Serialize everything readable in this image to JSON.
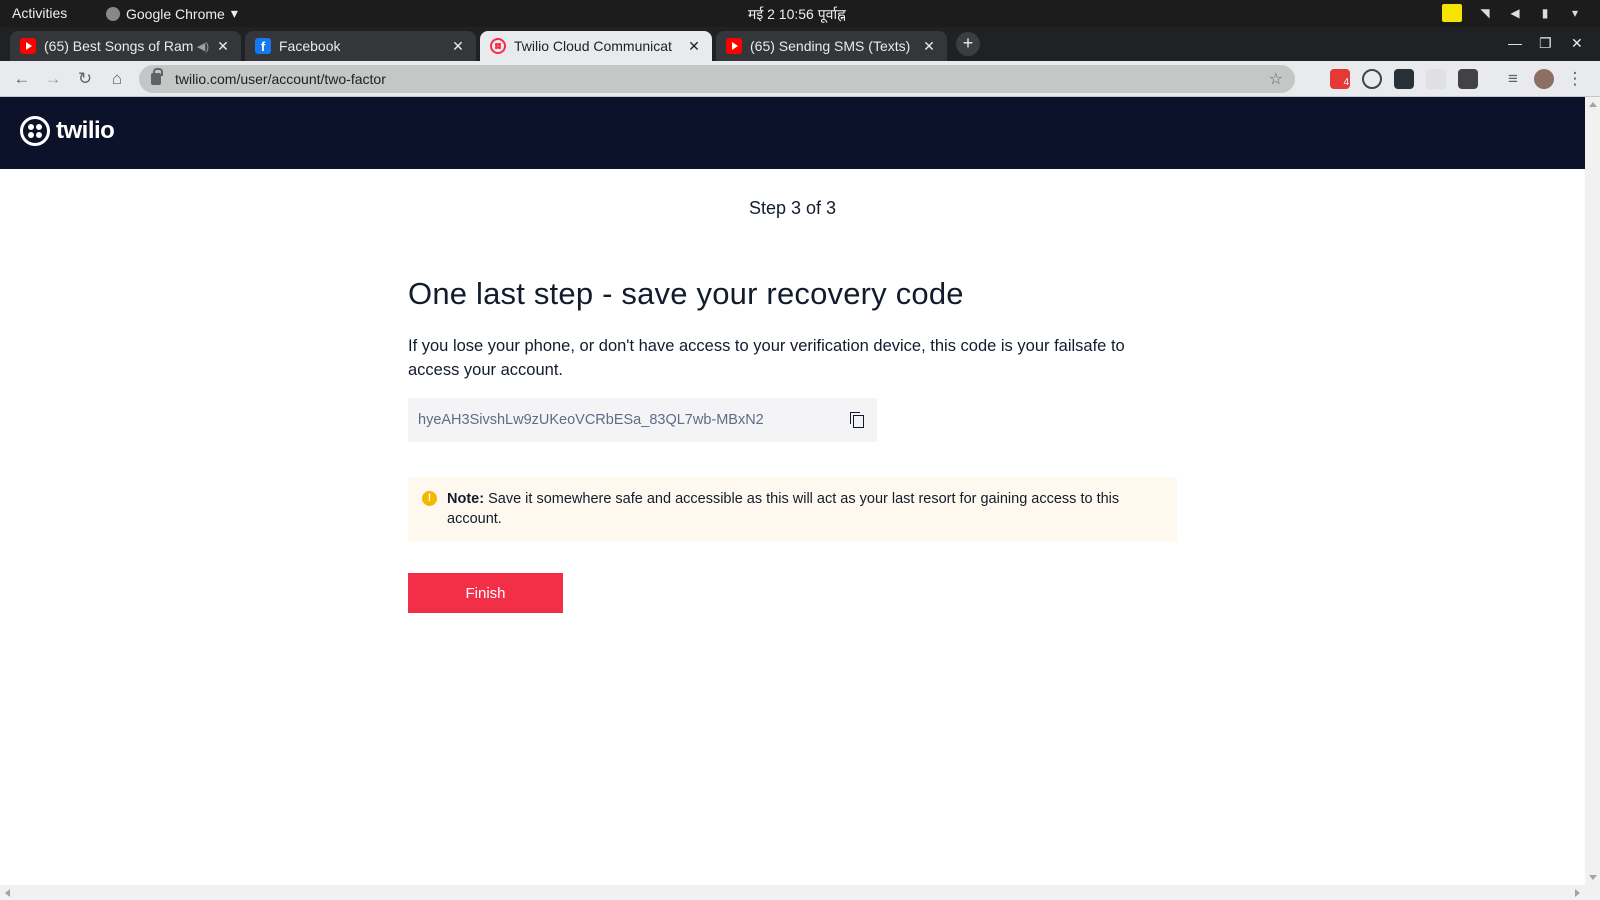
{
  "system_bar": {
    "activities": "Activities",
    "app_name": "Google Chrome",
    "clock": "मई 2  10:56 पूर्वाह्न"
  },
  "tabs": [
    {
      "title": "(65) Best Songs of Ram",
      "icon": "youtube-icon",
      "active": false
    },
    {
      "title": "Facebook",
      "icon": "facebook-icon",
      "active": false
    },
    {
      "title": "Twilio Cloud Communicat",
      "icon": "twilio-icon",
      "active": true
    },
    {
      "title": "(65) Sending SMS (Texts)",
      "icon": "youtube-icon",
      "active": false
    }
  ],
  "toolbar": {
    "url": "twilio.com/user/account/two-factor",
    "extension_badge": "4"
  },
  "site": {
    "logo_text": "twilio"
  },
  "main": {
    "step": "Step 3 of 3",
    "heading": "One last step - save your recovery code",
    "description": "If you lose your phone, or don't have access to your verification device, this code is your failsafe to access your account.",
    "recovery_code": "hyeAH3SivshLw9zUKeoVCRbESa_83QL7wb-MBxN2",
    "note_label": "Note:",
    "note_text": " Save it somewhere safe and accessible as this will act as your last resort for gaining access to this account.",
    "finish_label": "Finish"
  },
  "colors": {
    "brand_red": "#f22f46",
    "header_navy": "#0d122b",
    "note_bg": "#fef8ef",
    "warn": "#f5b800"
  }
}
